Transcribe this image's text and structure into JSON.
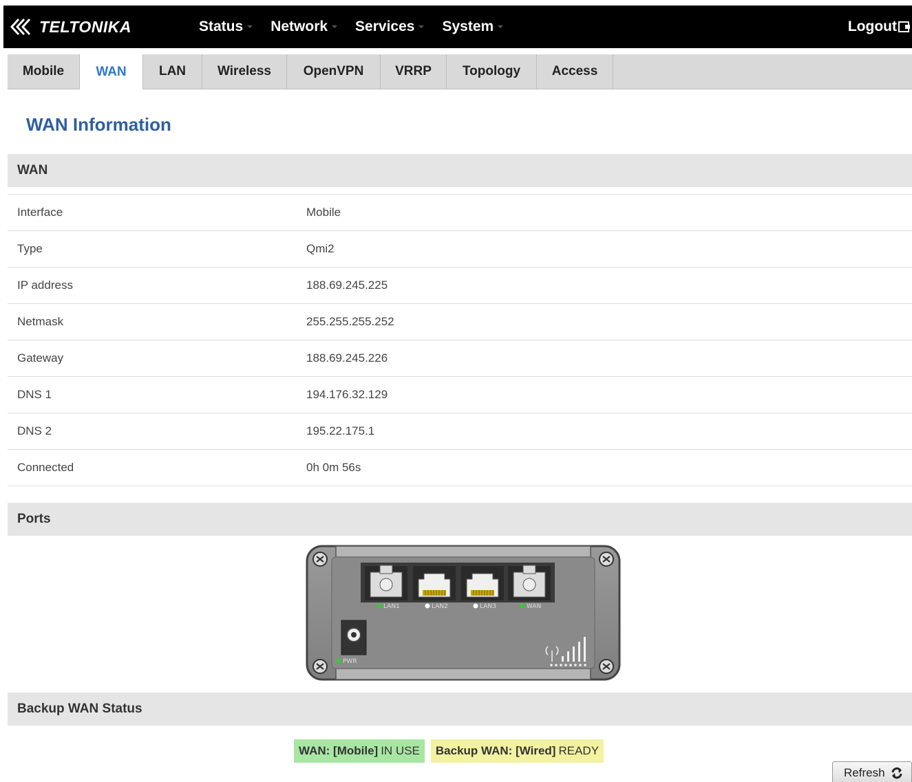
{
  "brand": {
    "name": "TELTONIKA"
  },
  "nav": {
    "items": [
      {
        "label": "Status",
        "name": "nav-status"
      },
      {
        "label": "Network",
        "name": "nav-network"
      },
      {
        "label": "Services",
        "name": "nav-services"
      },
      {
        "label": "System",
        "name": "nav-system"
      }
    ],
    "logout_label": "Logout"
  },
  "tabs": [
    {
      "label": "Mobile",
      "width": 105,
      "active": false
    },
    {
      "label": "WAN",
      "width": 92,
      "active": true
    },
    {
      "label": "LAN",
      "width": 86,
      "active": false
    },
    {
      "label": "Wireless",
      "width": 123,
      "active": false
    },
    {
      "label": "OpenVPN",
      "width": 136,
      "active": false
    },
    {
      "label": "VRRP",
      "width": 96,
      "active": false
    },
    {
      "label": "Topology",
      "width": 131,
      "active": false
    },
    {
      "label": "Access",
      "width": 111,
      "active": false
    }
  ],
  "page_title": "WAN Information",
  "sections": {
    "wan": "WAN",
    "ports": "Ports",
    "backup": "Backup WAN Status"
  },
  "wan_info": [
    {
      "label": "Interface",
      "value": "Mobile"
    },
    {
      "label": "Type",
      "value": "Qmi2"
    },
    {
      "label": "IP address",
      "value": "188.69.245.225"
    },
    {
      "label": "Netmask",
      "value": "255.255.255.252"
    },
    {
      "label": "Gateway",
      "value": "188.69.245.226"
    },
    {
      "label": "DNS 1",
      "value": "194.176.32.129"
    },
    {
      "label": "DNS 2",
      "value": "195.22.175.1"
    },
    {
      "label": "Connected",
      "value": "0h 0m 56s"
    }
  ],
  "ports": {
    "labels": [
      "LAN1",
      "LAN2",
      "LAN3",
      "WAN"
    ],
    "led_colors": [
      "#33cc33",
      "#ffffff",
      "#ffffff",
      "#33cc33"
    ],
    "pwr_label": "PWR",
    "pwr_led": "#33cc33"
  },
  "backup_status": {
    "primary_prefix": "WAN: [Mobile]",
    "primary_state": "IN USE",
    "backup_prefix": "Backup WAN: [Wired]",
    "backup_state": "READY"
  },
  "refresh_label": "Refresh",
  "colors": {
    "accent": "#2f79c6",
    "title": "#2e5fa0",
    "in_use": "#a8e6a3",
    "ready": "#f2f2a0"
  }
}
